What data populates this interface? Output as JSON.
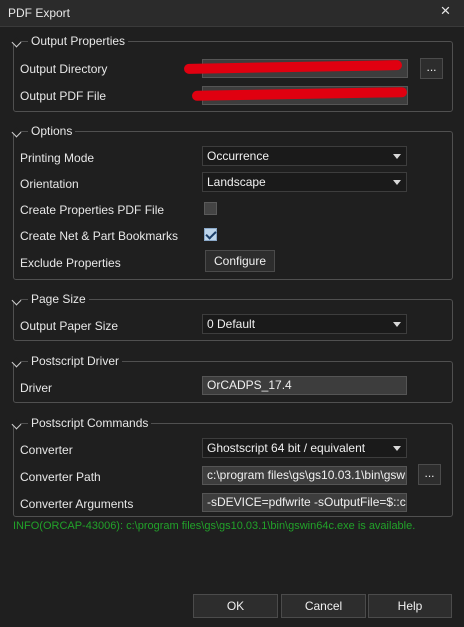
{
  "window": {
    "title": "PDF Export",
    "close_glyph": "×"
  },
  "output": {
    "title": "Output Properties",
    "directory_label": "Output Directory",
    "file_label": "Output PDF File",
    "browse_label": "..."
  },
  "options": {
    "title": "Options",
    "printing_mode_label": "Printing Mode",
    "printing_mode_value": "Occurrence",
    "orientation_label": "Orientation",
    "orientation_value": "Landscape",
    "create_props_label": "Create Properties PDF File",
    "create_props_checked": false,
    "bookmarks_label": "Create Net & Part Bookmarks",
    "bookmarks_checked": true,
    "exclude_label": "Exclude Properties",
    "configure_label": "Configure"
  },
  "page_size": {
    "title": "Page Size",
    "paper_label": "Output Paper Size",
    "paper_value": "0 Default"
  },
  "driver": {
    "title": "Postscript Driver",
    "driver_label": "Driver",
    "driver_value": "OrCADPS_17.4"
  },
  "commands": {
    "title": "Postscript Commands",
    "converter_label": "Converter",
    "converter_value": "Ghostscript 64 bit / equivalent",
    "path_label": "Converter Path",
    "path_value": "c:\\program files\\gs\\gs10.03.1\\bin\\gswin64c.exe",
    "args_label": "Converter Arguments",
    "args_value": "-sDEVICE=pdfwrite -sOutputFile=$::capPdfUtil::mPdfFilePath",
    "browse_label": "..."
  },
  "info_text": "INFO(ORCAP-43006): c:\\program files\\gs\\gs10.03.1\\bin\\gswin64c.exe is available.",
  "buttons": {
    "ok": "OK",
    "cancel": "Cancel",
    "help": "Help"
  },
  "colors": {
    "info": "#22a22a",
    "redaction": "#e00010",
    "check": "#bcd4ea"
  }
}
